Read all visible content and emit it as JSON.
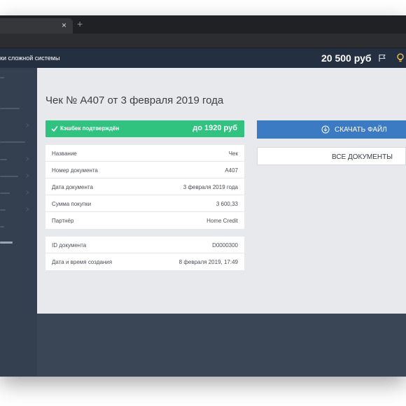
{
  "browser": {
    "tab_close": "×",
    "tab_add": "+"
  },
  "header": {
    "title": "ки сложной системы",
    "balance": "20 500 руб"
  },
  "page": {
    "title": "Чек № А407 от 3 февраля 2019 года"
  },
  "cashback": {
    "label": "Кэшбек подтверждён",
    "amount": "до 1920 руб",
    "color": "#2fc37f"
  },
  "details": [
    {
      "label": "Название",
      "value": "Чек"
    },
    {
      "label": "Номер документа",
      "value": "А407"
    },
    {
      "label": "Дата документа",
      "value": "3 февраля 2019 года"
    },
    {
      "label": "Сумма покупки",
      "value": "3 600,33"
    },
    {
      "label": "Партнёр",
      "value": "Home Credit"
    }
  ],
  "meta": [
    {
      "label": "ID документа",
      "value": "D0000300"
    },
    {
      "label": "Дата и время создания",
      "value": "8 февраля 2019, 17:49"
    }
  ],
  "actions": {
    "download_label": "СКАЧАТЬ ФАЙЛ",
    "all_docs_label": "ВСЕ ДОКУМЕНТЫ",
    "primary_color": "#3a7bc4"
  },
  "icons": {
    "download": "download-circle-icon",
    "check": "check-icon",
    "flag": "flag-icon",
    "bulb": "lightbulb-icon"
  }
}
